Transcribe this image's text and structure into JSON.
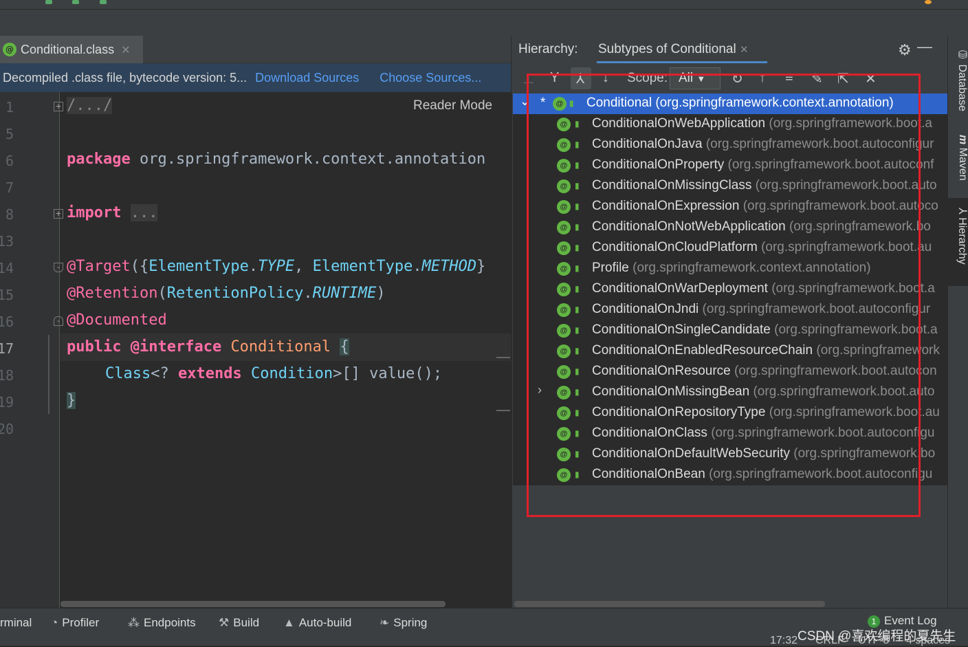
{
  "editor": {
    "tab_label": "Conditional.class",
    "banner_message": "Decompiled .class file, bytecode version: 5...",
    "download_sources": "Download Sources",
    "choose_sources": "Choose Sources...",
    "reader_mode": "Reader Mode",
    "line_numbers": [
      "1",
      "5",
      "6",
      "7",
      "8",
      "13",
      "14",
      "15",
      "16",
      "17",
      "18",
      "19",
      "20"
    ],
    "code": {
      "l1": "/.../",
      "l6_kw": "package",
      "l6_rest": " org.springframework.context.annotation",
      "l8_kw": "import",
      "l8_fold": "...",
      "l14_ann": "@Target",
      "l14_a": "({",
      "l14_c1": "ElementType",
      "l14_dot1": ".",
      "l14_i1": "TYPE",
      "l14_comma": ", ",
      "l14_c2": "ElementType",
      "l14_dot2": ".",
      "l14_i2": "METHOD",
      "l14_close": "}",
      "l15_ann": "@Retention",
      "l15_open": "(",
      "l15_c": "RetentionPolicy",
      "l15_dot": ".",
      "l15_i": "RUNTIME",
      "l15_close": ")",
      "l16_ann": "@Documented",
      "l17_kw1": "public",
      "l17_kw2": "@interface",
      "l17_name": "Conditional",
      "l17_brace": "{",
      "l18_c1": "Class",
      "l18_gen": "<? ",
      "l18_kw": "extends",
      "l18_c2": "Condition",
      "l18_rest": ">[] ",
      "l18_m": "value",
      "l18_end": "();",
      "l19": "}"
    }
  },
  "hierarchy": {
    "label": "Hierarchy:",
    "tab": "Subtypes of Conditional",
    "scope_label": "Scope:",
    "scope_value": "All",
    "root": {
      "name": "Conditional",
      "pkg": "(org.springframework.context.annotation)"
    },
    "items": [
      {
        "name": "ConditionalOnWebApplication",
        "pkg": "(org.springframework.boot.a"
      },
      {
        "name": "ConditionalOnJava",
        "pkg": "(org.springframework.boot.autoconfigur"
      },
      {
        "name": "ConditionalOnProperty",
        "pkg": "(org.springframework.boot.autoconf"
      },
      {
        "name": "ConditionalOnMissingClass",
        "pkg": "(org.springframework.boot.auto"
      },
      {
        "name": "ConditionalOnExpression",
        "pkg": "(org.springframework.boot.autoco"
      },
      {
        "name": "ConditionalOnNotWebApplication",
        "pkg": "(org.springframework.bo"
      },
      {
        "name": "ConditionalOnCloudPlatform",
        "pkg": "(org.springframework.boot.au"
      },
      {
        "name": "Profile",
        "pkg": "(org.springframework.context.annotation)"
      },
      {
        "name": "ConditionalOnWarDeployment",
        "pkg": "(org.springframework.boot.a"
      },
      {
        "name": "ConditionalOnJndi",
        "pkg": "(org.springframework.boot.autoconfigur"
      },
      {
        "name": "ConditionalOnSingleCandidate",
        "pkg": "(org.springframework.boot.a"
      },
      {
        "name": "ConditionalOnEnabledResourceChain",
        "pkg": "(org.springframework"
      },
      {
        "name": "ConditionalOnResource",
        "pkg": "(org.springframework.boot.autocon"
      },
      {
        "name": "ConditionalOnMissingBean",
        "pkg": "(org.springframework.boot.auto"
      },
      {
        "name": "ConditionalOnRepositoryType",
        "pkg": "(org.springframework.boot.au"
      },
      {
        "name": "ConditionalOnClass",
        "pkg": "(org.springframework.boot.autoconfigu"
      },
      {
        "name": "ConditionalOnDefaultWebSecurity",
        "pkg": "(org.springframework.bo"
      },
      {
        "name": "ConditionalOnBean",
        "pkg": "(org.springframework.boot.autoconfigu"
      }
    ]
  },
  "right_stripe": {
    "database": "Database",
    "maven": "Maven",
    "hierarchy": "Hierarchy"
  },
  "bottom": {
    "terminal": "rminal",
    "profiler": "Profiler",
    "endpoints": "Endpoints",
    "build": "Build",
    "autobuild": "Auto-build",
    "spring": "Spring",
    "event_count": "1",
    "event_log": "Event Log",
    "time": "17:32",
    "crlf": "CRLF",
    "encoding": "UTF-8",
    "indent": "4 spaces",
    "watermark": "CSDN @喜欢编程的夏先生"
  },
  "colors": {
    "accent": "#2f65ca",
    "highlight_box": "#e0202a",
    "annotation_badge": "#62b543"
  }
}
